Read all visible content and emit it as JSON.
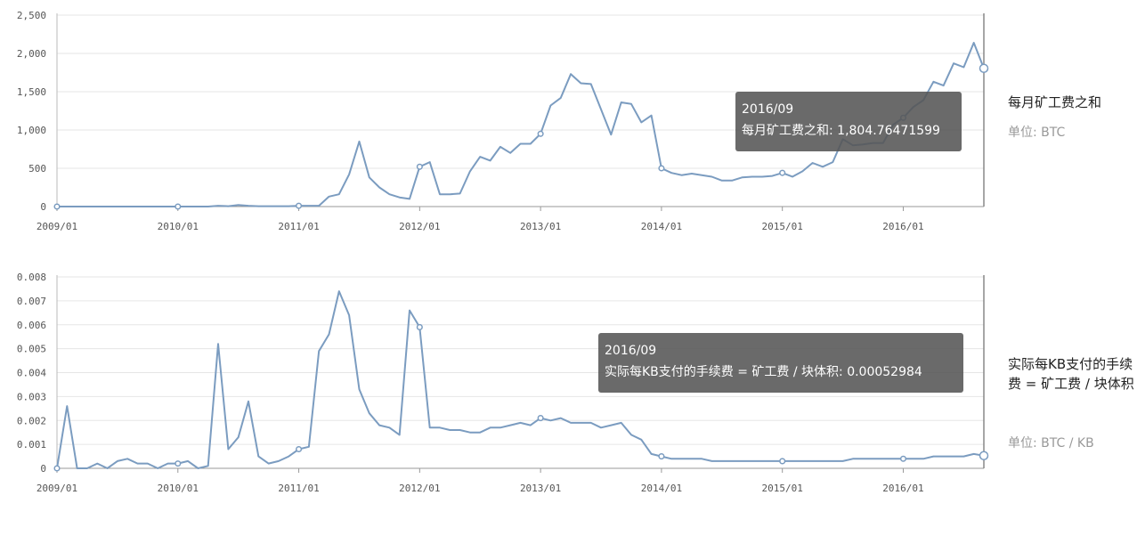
{
  "chart_data": [
    {
      "type": "line",
      "title": "每月矿工费之和",
      "unit_label": "单位: BTC",
      "ylim": [
        0,
        2500
      ],
      "yticks": [
        "0",
        "500",
        "1,000",
        "1,500",
        "2,000",
        "2,500"
      ],
      "yticks_values": [
        0,
        500,
        1000,
        1500,
        2000,
        2500
      ],
      "xticks": [
        "2009/01",
        "2010/01",
        "2011/01",
        "2012/01",
        "2013/01",
        "2014/01",
        "2015/01",
        "2016/01"
      ],
      "x_start": "2009/01",
      "grid": true,
      "color": "#7b9cc0",
      "tooltip": {
        "date": "2016/09",
        "text": "每月矿工费之和: 1,804.76471599"
      },
      "markers": [
        0,
        12,
        24,
        36,
        48,
        60,
        72,
        84,
        92
      ],
      "values": [
        0,
        0,
        0,
        0,
        0,
        0,
        0,
        0,
        0,
        0,
        0,
        0,
        0,
        0,
        0,
        0,
        10,
        5,
        20,
        10,
        5,
        5,
        5,
        5,
        10,
        10,
        10,
        130,
        160,
        420,
        850,
        380,
        250,
        160,
        120,
        100,
        520,
        580,
        160,
        160,
        170,
        460,
        650,
        600,
        780,
        700,
        820,
        820,
        950,
        1320,
        1420,
        1730,
        1610,
        1600,
        1270,
        940,
        1360,
        1340,
        1100,
        1190,
        500,
        440,
        410,
        430,
        410,
        390,
        340,
        340,
        380,
        390,
        390,
        400,
        440,
        390,
        460,
        570,
        520,
        580,
        880,
        800,
        810,
        830,
        830,
        1070,
        1160,
        1300,
        1390,
        1630,
        1580,
        1870,
        1820,
        2140,
        1805
      ]
    },
    {
      "type": "line",
      "title": "实际每KB支付的手续费 = 矿工费 / 块体积",
      "unit_label": "单位: BTC / KB",
      "ylim": [
        0,
        0.008
      ],
      "yticks": [
        "0",
        "0.001",
        "0.002",
        "0.003",
        "0.004",
        "0.005",
        "0.006",
        "0.007",
        "0.008"
      ],
      "yticks_values": [
        0,
        0.001,
        0.002,
        0.003,
        0.004,
        0.005,
        0.006,
        0.007,
        0.008
      ],
      "xticks": [
        "2009/01",
        "2010/01",
        "2011/01",
        "2012/01",
        "2013/01",
        "2014/01",
        "2015/01",
        "2016/01"
      ],
      "x_start": "2009/01",
      "grid": true,
      "color": "#7b9cc0",
      "tooltip": {
        "date": "2016/09",
        "text": "实际每KB支付的手续费 = 矿工费 / 块体积: 0.00052984"
      },
      "markers": [
        0,
        12,
        24,
        36,
        48,
        60,
        72,
        84,
        92
      ],
      "values": [
        0,
        0.0026,
        0,
        0,
        0.0002,
        0,
        0.0003,
        0.0004,
        0.0002,
        0.0002,
        0,
        0.0002,
        0.0002,
        0.0003,
        0,
        0.0001,
        0.0052,
        0.0008,
        0.0013,
        0.0028,
        0.0005,
        0.0002,
        0.0003,
        0.0005,
        0.0008,
        0.0009,
        0.0049,
        0.0056,
        0.0074,
        0.0064,
        0.0033,
        0.0023,
        0.0018,
        0.0017,
        0.0014,
        0.0066,
        0.0059,
        0.0017,
        0.0017,
        0.0016,
        0.0016,
        0.0015,
        0.0015,
        0.0017,
        0.0017,
        0.0018,
        0.0019,
        0.0018,
        0.0021,
        0.002,
        0.0021,
        0.0019,
        0.0019,
        0.0019,
        0.0017,
        0.0018,
        0.0019,
        0.0014,
        0.0012,
        0.0006,
        0.0005,
        0.0004,
        0.0004,
        0.0004,
        0.0004,
        0.0003,
        0.0003,
        0.0003,
        0.0003,
        0.0003,
        0.0003,
        0.0003,
        0.0003,
        0.0003,
        0.0003,
        0.0003,
        0.0003,
        0.0003,
        0.0003,
        0.0004,
        0.0004,
        0.0004,
        0.0004,
        0.0004,
        0.0004,
        0.0004,
        0.0004,
        0.0005,
        0.0005,
        0.0005,
        0.0005,
        0.0006,
        0.00052984
      ]
    }
  ],
  "side_panels": [
    {
      "title": "每月矿工费之和",
      "unit": "单位: BTC"
    },
    {
      "title": "实际每KB支付的手续费 = 矿工费 / 块体积",
      "unit": "单位: BTC / KB"
    }
  ]
}
